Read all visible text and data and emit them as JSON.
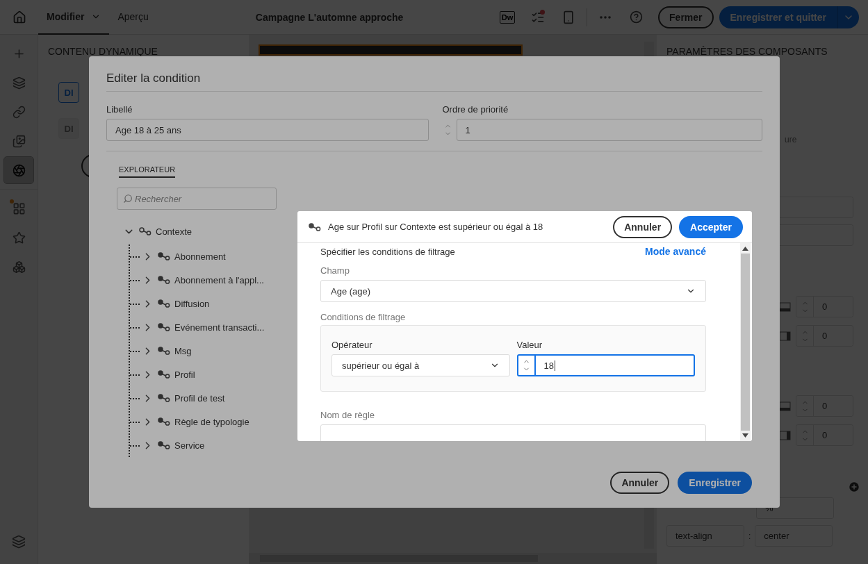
{
  "topbar": {
    "tabs": [
      {
        "label": "Modifier",
        "selected": true,
        "has_menu": true
      },
      {
        "label": "Aperçu",
        "selected": false,
        "has_menu": false
      }
    ],
    "title": "Campagne L'automne approche",
    "dw_label": "Dw",
    "notification_dot": true,
    "close_button": "Fermer",
    "save_button": "Enregistrer et quitter"
  },
  "rail": {
    "items": [
      {
        "selected": false,
        "badge": false
      },
      {
        "selected": false,
        "badge": false
      },
      {
        "selected": false,
        "badge": false
      },
      {
        "selected": false,
        "badge": false
      },
      {
        "selected": true,
        "badge": false
      },
      {
        "selected": false,
        "badge": true
      },
      {
        "selected": false,
        "badge": false
      },
      {
        "selected": false,
        "badge": false
      }
    ]
  },
  "left_panel": {
    "heading": "CONTENU DYNAMIQUE",
    "cards": [
      {
        "label": "DI",
        "selected": true
      },
      {
        "label": "DI",
        "selected": false
      }
    ]
  },
  "right_panel": {
    "heading": "PARAMÈTRES DES COMPOSANTS",
    "hint_fragment": "ure",
    "spacing_rows": [
      {
        "kind": "bottom",
        "value": "0"
      },
      {
        "kind": "right",
        "value": "0"
      },
      {
        "kind": "bottom",
        "value": "0"
      },
      {
        "kind": "right",
        "value": "0"
      }
    ],
    "styles": [
      {
        "value": "%"
      },
      {
        "property": "text-align",
        "separator": ":",
        "value": "center"
      }
    ]
  },
  "dialog": {
    "title": "Editer la condition",
    "label_field": {
      "label": "Libellé",
      "value": "Age 18 à 25 ans"
    },
    "priority_field": {
      "label": "Ordre de priorité",
      "value": "1"
    },
    "explorer": {
      "tab": "EXPLORATEUR",
      "search_placeholder": "Rechercher",
      "tree": [
        {
          "label": "Contexte",
          "expanded": true,
          "children": [
            {
              "label": "Abonnement",
              "expanded": false
            },
            {
              "label": "Abonnement à l'appl...",
              "expanded": false
            },
            {
              "label": "Diffusion",
              "expanded": false
            },
            {
              "label": "Evénement transacti...",
              "expanded": false
            },
            {
              "label": "Msg",
              "expanded": false
            },
            {
              "label": "Profil",
              "expanded": false
            },
            {
              "label": "Profil de test",
              "expanded": false
            },
            {
              "label": "Règle de typologie",
              "expanded": false
            },
            {
              "label": "Service",
              "expanded": false
            }
          ]
        }
      ]
    },
    "cancel_button": "Annuler",
    "save_button": "Enregistrer"
  },
  "filter_dialog": {
    "summary": "Age sur Profil sur Contexte est supérieur ou égal à 18",
    "cancel_button": "Annuler",
    "accept_button": "Accepter",
    "section_title": "Spécifier les conditions de filtrage",
    "advanced_link": "Mode avancé",
    "field": {
      "label": "Champ",
      "value": "Age (age)"
    },
    "conditions_label": "Conditions de filtrage",
    "operator": {
      "label": "Opérateur",
      "value": "supérieur ou égal à"
    },
    "value": {
      "label": "Valeur",
      "value": "18",
      "focused": true
    },
    "rule_name": {
      "label": "Nom de règle"
    }
  }
}
